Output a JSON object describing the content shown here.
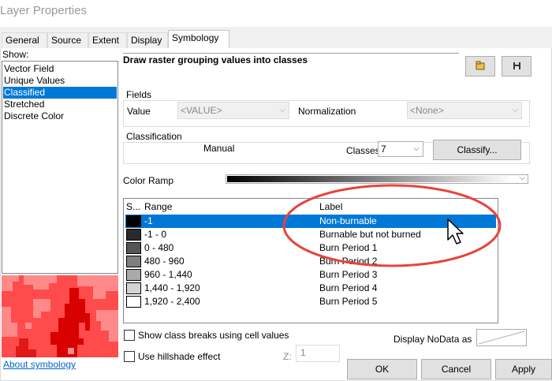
{
  "window": {
    "title": "Layer Properties"
  },
  "tabs": [
    {
      "label": "General",
      "active": false
    },
    {
      "label": "Source",
      "active": false
    },
    {
      "label": "Extent",
      "active": false
    },
    {
      "label": "Display",
      "active": false
    },
    {
      "label": "Symbology",
      "active": true
    }
  ],
  "show": {
    "label": "Show:",
    "items": [
      {
        "label": "Vector Field",
        "selected": false
      },
      {
        "label": "Unique Values",
        "selected": false
      },
      {
        "label": "Classified",
        "selected": true
      },
      {
        "label": "Stretched",
        "selected": false
      },
      {
        "label": "Discrete Color",
        "selected": false
      }
    ]
  },
  "about_link": "About symbology",
  "heading": "Draw raster grouping values into classes",
  "toolbar": {
    "open_icon": "folder-open-icon",
    "save_icon": "save-icon"
  },
  "fields": {
    "group_label": "Fields",
    "value_label": "Value",
    "value_selected": "<VALUE>",
    "normalization_label": "Normalization",
    "normalization_selected": "<None>"
  },
  "classification": {
    "group_label": "Classification",
    "method": "Manual",
    "classes_label": "Classes",
    "classes_value": "7",
    "classify_button": "Classify..."
  },
  "color_ramp": {
    "label": "Color Ramp",
    "start_color": "#000000",
    "end_color": "#ffffff"
  },
  "table": {
    "headers": {
      "symbol": "S...",
      "range": "Range",
      "label": "Label"
    },
    "rows": [
      {
        "color": "#000000",
        "range": "-1",
        "label": "Non-burnable",
        "selected": true
      },
      {
        "color": "#2a2a2a",
        "range": "-1 - 0",
        "label": "Burnable but not burned",
        "selected": false
      },
      {
        "color": "#555555",
        "range": "0 - 480",
        "label": "Burn Period 1",
        "selected": false
      },
      {
        "color": "#7f7f7f",
        "range": "480 - 960",
        "label": "Burn Period 2",
        "selected": false
      },
      {
        "color": "#aaaaaa",
        "range": "960 - 1,440",
        "label": "Burn Period 3",
        "selected": false
      },
      {
        "color": "#d4d4d4",
        "range": "1,440 - 1,920",
        "label": "Burn Period 4",
        "selected": false
      },
      {
        "color": "#ffffff",
        "range": "1,920 - 2,400",
        "label": "Burn Period 5",
        "selected": false
      }
    ]
  },
  "options": {
    "show_breaks": "Show class breaks using cell values",
    "hillshade": "Use hillshade effect",
    "z_label": "Z:",
    "z_value": "1",
    "nodata_label": "Display NoData as"
  },
  "buttons": {
    "ok": "OK",
    "cancel": "Cancel",
    "apply": "Apply"
  },
  "colors": {
    "accent": "#0078d7",
    "annotation_ellipse": "#e8443a",
    "preview_light": "#ff7b7b",
    "preview_dark": "#d90000"
  }
}
